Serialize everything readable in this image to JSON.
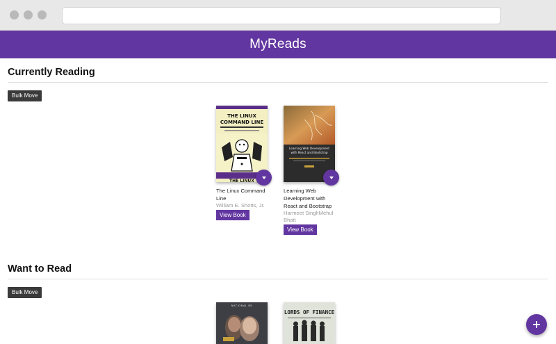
{
  "app": {
    "title": "MyReads"
  },
  "shelves": [
    {
      "title": "Currently Reading",
      "bulk_move_label": "Bulk Move",
      "books": [
        {
          "title": "The Linux Command Line",
          "authors": "William E. Shotts, Jr.",
          "view_label": "View Book",
          "cover_text": [
            "THE LINUX",
            "COMMAND LINE"
          ]
        },
        {
          "title": "Learning Web Development with React and Bootstrap",
          "authors": "Harmeet SinghMehul Bhatt",
          "view_label": "View Book",
          "cover_text": [
            "Learning Web Development",
            "with React and Bootstrap"
          ]
        }
      ]
    },
    {
      "title": "Want to Read",
      "bulk_move_label": "Bulk Move",
      "books": [
        {
          "cover_text": [
            "NATIONAL BE"
          ]
        },
        {
          "cover_text": [
            "LORDS OF FINANCE"
          ]
        }
      ]
    }
  ],
  "colors": {
    "accent": "#6236a0",
    "dark_button": "#3a3a3a"
  },
  "icons": {
    "shelf_changer": "triangle-down-icon",
    "add": "plus-icon"
  }
}
